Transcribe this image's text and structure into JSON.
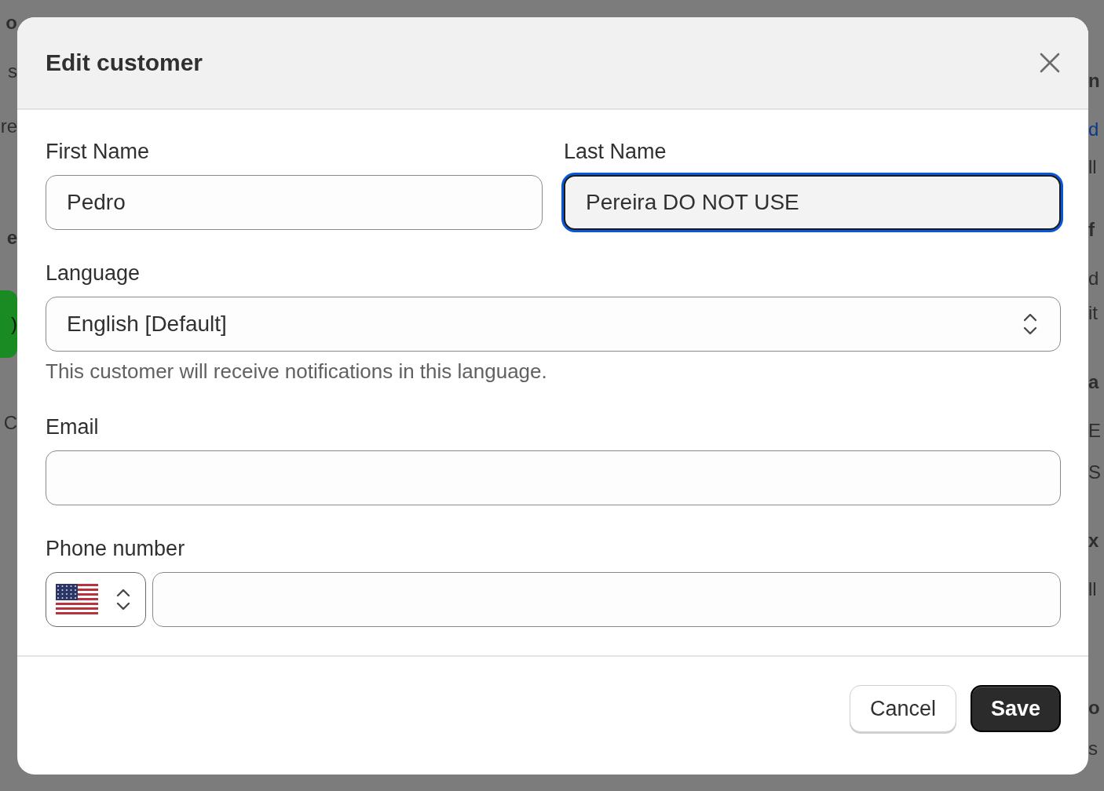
{
  "background": {
    "left": [
      {
        "text": "o",
        "kind": "bold"
      },
      {
        "text": "s",
        "kind": "text"
      },
      {
        "text": "re",
        "kind": "text"
      },
      {
        "text": "e",
        "kind": "bold"
      },
      {
        "text": ")",
        "kind": "button"
      },
      {
        "text": "C",
        "kind": "text"
      }
    ],
    "right": [
      {
        "text": "n",
        "kind": "bold"
      },
      {
        "text": "d",
        "kind": "link"
      },
      {
        "text": "ll",
        "kind": "text"
      },
      {
        "text": "f",
        "kind": "bold"
      },
      {
        "text": "d",
        "kind": "text"
      },
      {
        "text": "it",
        "kind": "text"
      },
      {
        "text": "a",
        "kind": "bold"
      },
      {
        "text": "E",
        "kind": "text"
      },
      {
        "text": "S",
        "kind": "text"
      },
      {
        "text": "x",
        "kind": "bold"
      },
      {
        "text": "ll",
        "kind": "text"
      },
      {
        "text": "o",
        "kind": "bold"
      },
      {
        "text": "s",
        "kind": "text"
      }
    ]
  },
  "dialog": {
    "title": "Edit customer",
    "fields": [
      {
        "label": "First Name",
        "value": "Pedro",
        "focused": false
      },
      {
        "label": "Last Name",
        "value": "Pereira DO NOT USE",
        "focused": true
      }
    ],
    "language": {
      "label": "Language",
      "value": "English [Default]",
      "help": "This customer will receive notifications in this language."
    },
    "email": {
      "label": "Email"
    },
    "phone": {
      "label": "Phone number"
    },
    "buttons": [
      {
        "label": "Cancel",
        "kind": "secondary"
      },
      {
        "label": "Save",
        "kind": "primary"
      }
    ]
  }
}
